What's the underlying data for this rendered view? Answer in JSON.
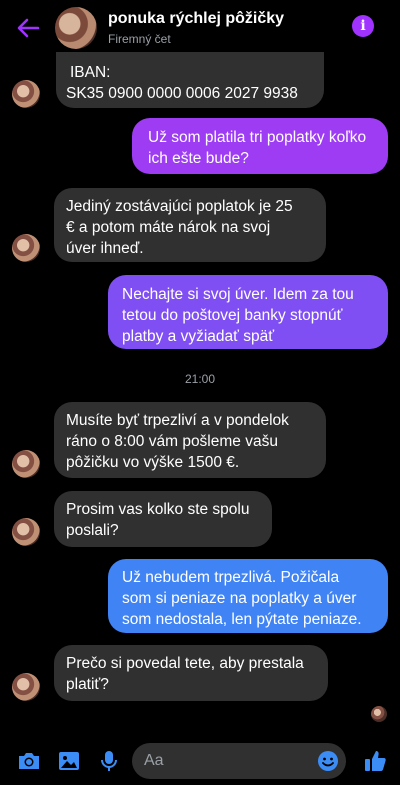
{
  "header": {
    "title": "ponuka rýchlej pôžičky",
    "subtitle": "Firemný čet",
    "accent": "#a033ff"
  },
  "messages": [
    {
      "side": "in",
      "lines": [
        "IBAN:",
        "SK35 0900 0000 0006 2027 9938"
      ]
    },
    {
      "side": "out",
      "lines": [
        "Už som platila tri poplatky koľko",
        "ich ešte bude?"
      ]
    },
    {
      "side": "in",
      "lines": [
        "Jediný zostávajúci poplatok je 25",
        "€ a potom máte nárok na svoj",
        "úver ihneď."
      ]
    },
    {
      "side": "out",
      "lines": [
        "Nechajte si svoj úver. Idem za tou",
        "tetou do poštovej banky stopnúť",
        "platby a vyžiadať späť"
      ]
    },
    {
      "side": "in",
      "lines": [
        "Musíte byť trpezliví a v pondelok",
        "ráno o 8:00 vám pošleme vašu",
        "pôžičku vo výške 1500 €."
      ]
    },
    {
      "side": "in",
      "lines": [
        "Prosim vas kolko ste spolu",
        "poslali?"
      ]
    },
    {
      "side": "out",
      "lines": [
        "Už nebudem trpezlivá. Požičala",
        "som si peniaze na poplatky a úver",
        "som nedostala, len pýtate peniaze."
      ]
    },
    {
      "side": "in",
      "lines": [
        "Prečo si povedal tete, aby prestala",
        "platiť?"
      ]
    }
  ],
  "timestamp": "21:00",
  "composer": {
    "placeholder": "Aa",
    "icons": [
      "camera-icon",
      "image-icon",
      "microphone-icon",
      "emoji-icon",
      "thumbs-up-icon"
    ]
  },
  "colors": {
    "outgoing_purple": "#9d3cf2",
    "outgoing_violet": "#7f4ff3",
    "outgoing_blue": "#3f83f4",
    "incoming": "#303030",
    "icon_blue": "#3b8cf5"
  }
}
